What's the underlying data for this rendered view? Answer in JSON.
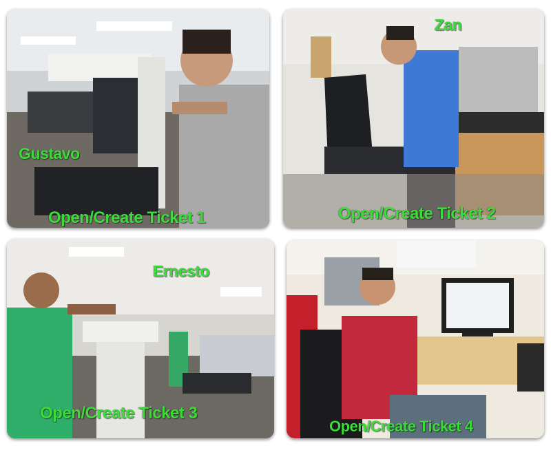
{
  "tiles": [
    {
      "person": "Gustavo",
      "caption": "Open/Create Ticket 1"
    },
    {
      "person": "Zan",
      "caption": "Open/Create Ticket 2"
    },
    {
      "person": "Ernesto",
      "caption": "Open/Create Ticket 3"
    },
    {
      "person": "",
      "caption": "Open/Create Ticket 4"
    }
  ],
  "colors": {
    "label_green": "#3ddb3a",
    "background": "#ffffff"
  }
}
